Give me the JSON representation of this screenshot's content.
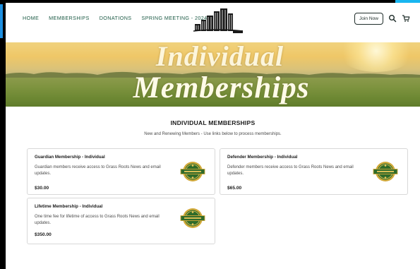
{
  "nav": {
    "items": [
      "HOME",
      "MEMBERSHIPS",
      "DONATIONS",
      "SPRING MEETING - 2024"
    ]
  },
  "header": {
    "join_label": "Join Now",
    "search_icon": "search-icon",
    "cart_icon": "cart-icon"
  },
  "hero": {
    "line1": "Individual",
    "line2": "Memberships"
  },
  "main": {
    "title": "INDIVIDUAL MEMBERSHIPS",
    "subtitle": "New and Renewing Members - Use links below to process memberships.",
    "cards": [
      {
        "title": "Guardian Membership - Individual",
        "description": "Guardian members receive access to Grass Roots News and email updates.",
        "price": "$30.00"
      },
      {
        "title": "Defender Membership - Individual",
        "description": "Defender members receive access to Grass Roots News and email updates.",
        "price": "$65.00"
      },
      {
        "title": "Lifetime Membership - Individual",
        "description": "One time fee for lifetime of access to Grass Roots News and email updates.",
        "price": "$350.00"
      }
    ]
  },
  "colors": {
    "nav_text": "#1c5a45",
    "badge_green": "#2f6b2a",
    "badge_gold": "#d1a93a",
    "accent_blue": "#19b6f0"
  }
}
